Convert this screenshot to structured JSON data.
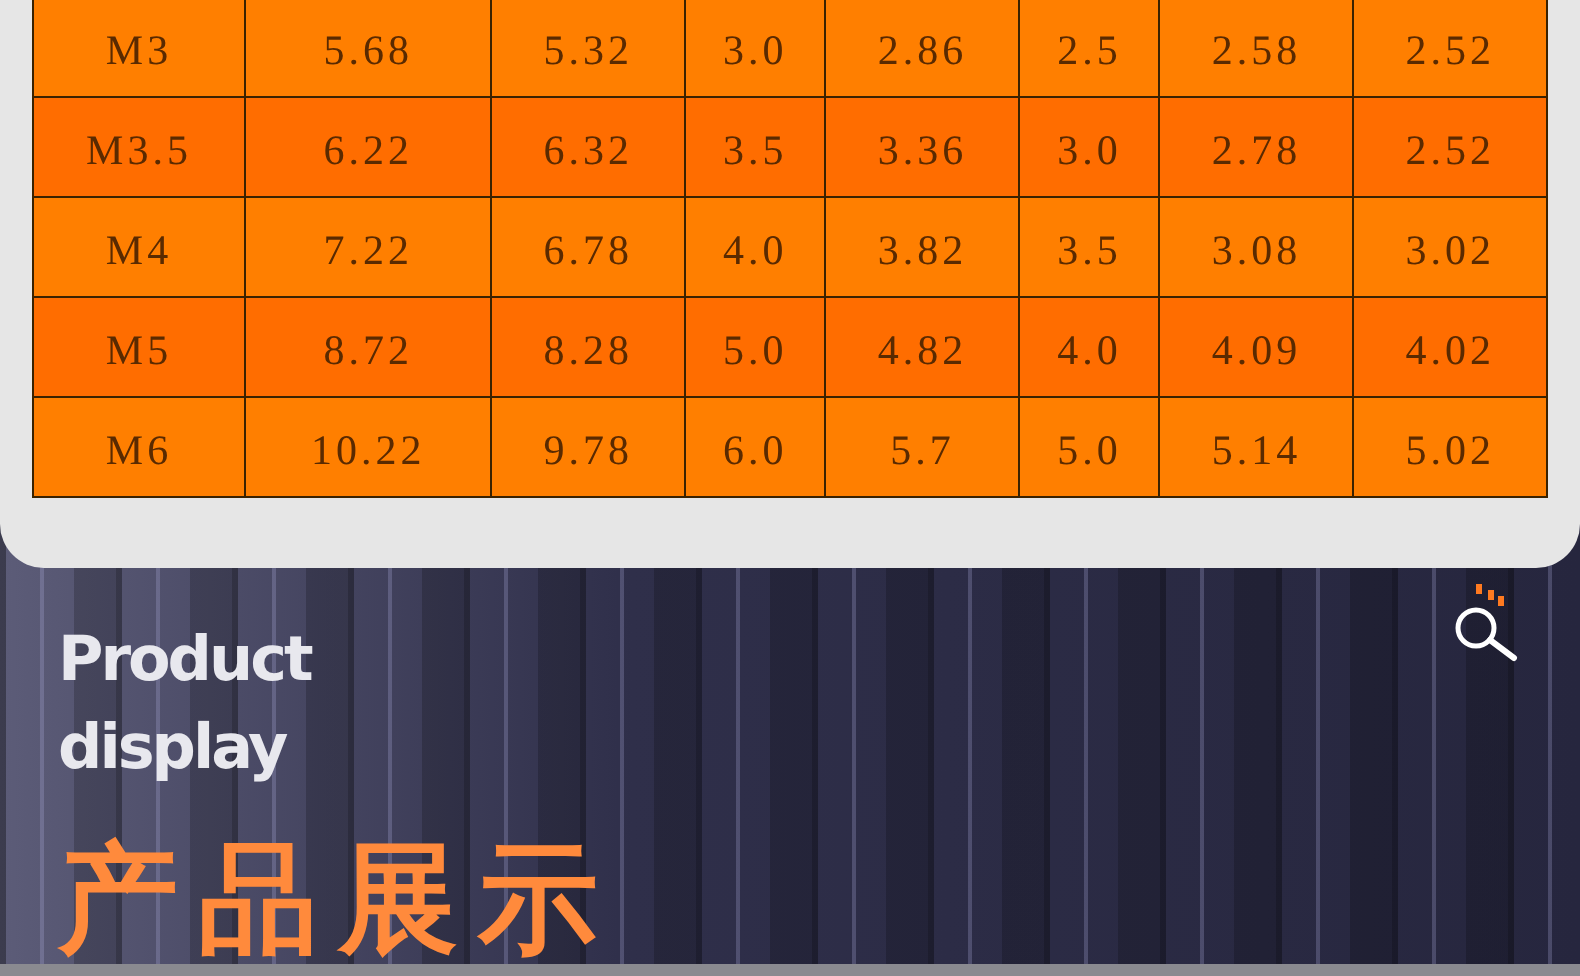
{
  "spec_table": {
    "rows": [
      {
        "highlighted": false,
        "cells": [
          "M3",
          "5.68",
          "5.32",
          "3.0",
          "2.86",
          "2.5",
          "2.58",
          "2.52"
        ]
      },
      {
        "highlighted": true,
        "cells": [
          "M3.5",
          "6.22",
          "6.32",
          "3.5",
          "3.36",
          "3.0",
          "2.78",
          "2.52"
        ]
      },
      {
        "highlighted": false,
        "cells": [
          "M4",
          "7.22",
          "6.78",
          "4.0",
          "3.82",
          "3.5",
          "3.08",
          "3.02"
        ]
      },
      {
        "highlighted": true,
        "cells": [
          "M5",
          "8.72",
          "8.28",
          "5.0",
          "4.82",
          "4.0",
          "4.09",
          "4.02"
        ]
      },
      {
        "highlighted": false,
        "cells": [
          "M6",
          "10.22",
          "9.78",
          "6.0",
          "5.7",
          "5.0",
          "5.14",
          "5.02"
        ]
      }
    ]
  },
  "product_display": {
    "english_title": [
      "Product",
      "display"
    ],
    "chinese_title": "产品展示"
  }
}
